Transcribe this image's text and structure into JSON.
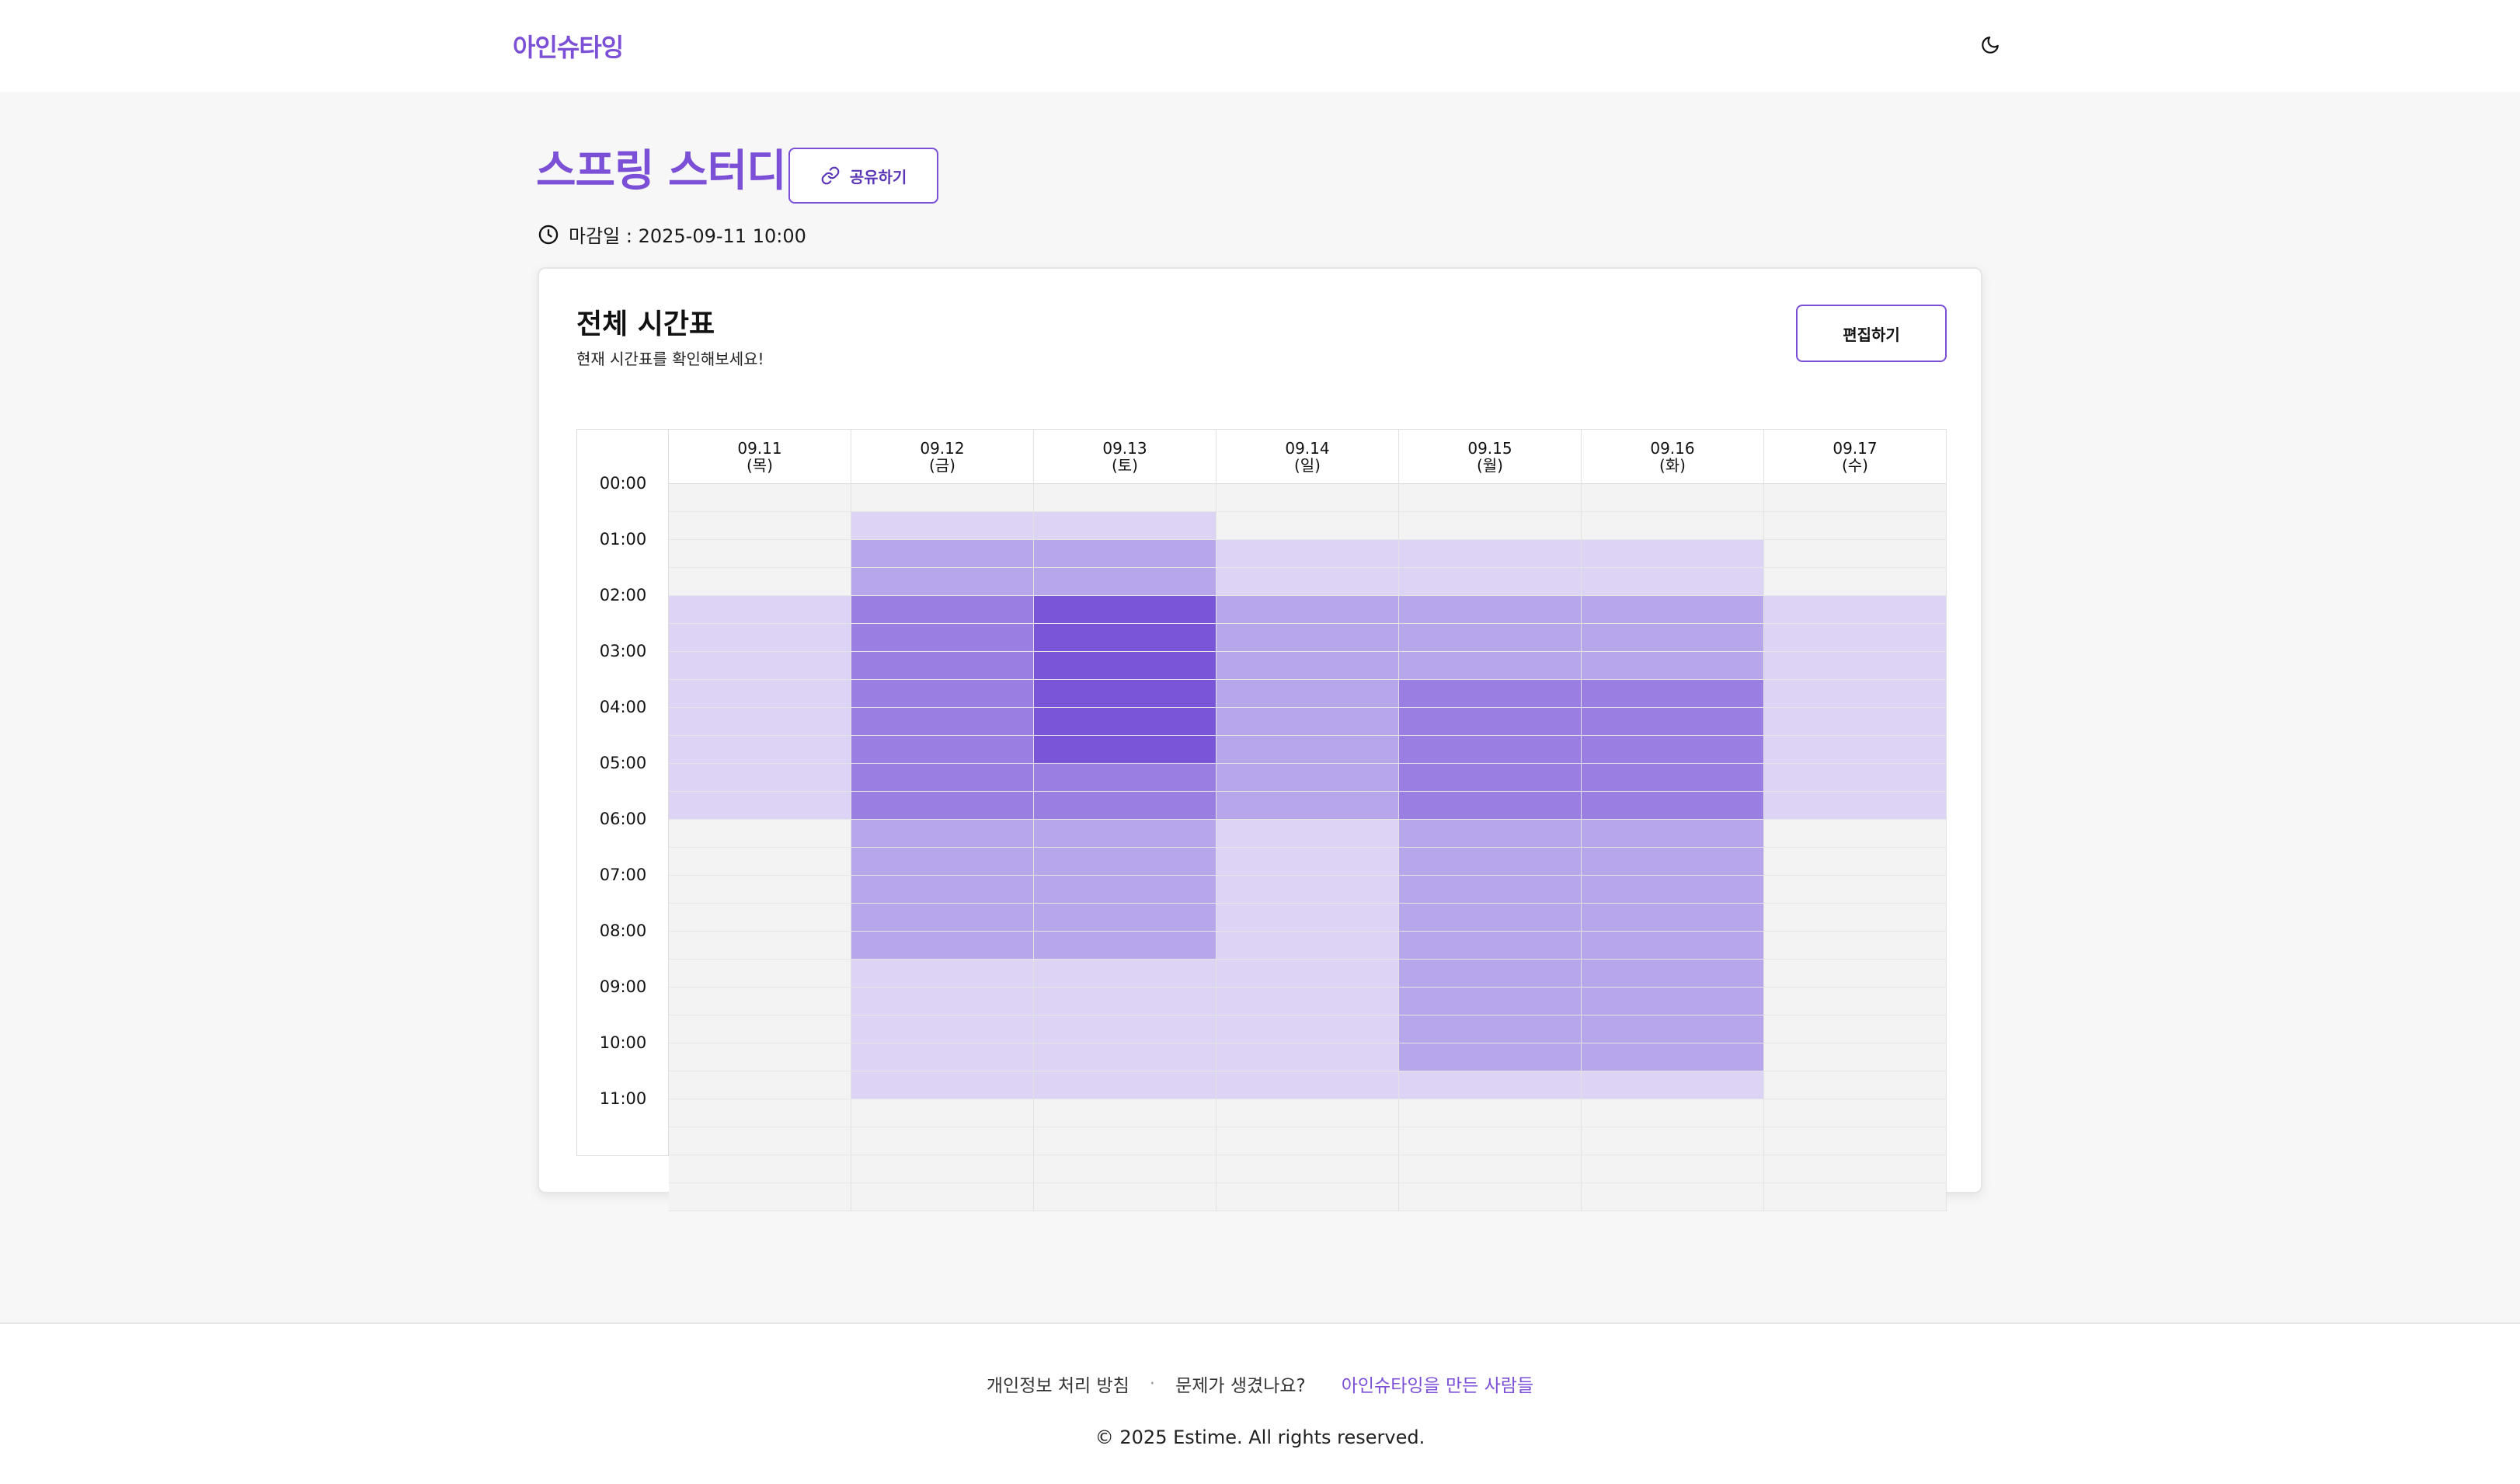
{
  "app": {
    "logo": "아인슈타잉",
    "theme_toggle_icon": "moon-icon"
  },
  "meeting": {
    "title": "스프링 스터디",
    "share_label": "공유하기",
    "deadline": "마감일 : 2025-09-11 10:00"
  },
  "timetable": {
    "title": "전체 시간표",
    "subtitle": "현재 시간표를 확인해보세요!",
    "edit_label": "편집하기",
    "days": [
      {
        "date": "09.11",
        "weekday": "(목)"
      },
      {
        "date": "09.12",
        "weekday": "(금)"
      },
      {
        "date": "09.13",
        "weekday": "(토)"
      },
      {
        "date": "09.14",
        "weekday": "(일)"
      },
      {
        "date": "09.15",
        "weekday": "(월)"
      },
      {
        "date": "09.16",
        "weekday": "(화)"
      },
      {
        "date": "09.17",
        "weekday": "(수)"
      }
    ],
    "time_labels": [
      "00:00",
      "01:00",
      "02:00",
      "03:00",
      "04:00",
      "05:00",
      "06:00",
      "07:00",
      "08:00",
      "09:00",
      "10:00",
      "11:00"
    ],
    "availability_levels_per_half_hour": [
      [
        0,
        0,
        0,
        0,
        1,
        1,
        1,
        1,
        1,
        1,
        1,
        1,
        0,
        0,
        0,
        0,
        0,
        0,
        0,
        0,
        0,
        0,
        0,
        0,
        0,
        0
      ],
      [
        0,
        1,
        2,
        2,
        3,
        3,
        3,
        3,
        3,
        3,
        3,
        3,
        2,
        2,
        2,
        2,
        2,
        1,
        1,
        1,
        1,
        1,
        0,
        0,
        0,
        0
      ],
      [
        0,
        1,
        2,
        2,
        4,
        4,
        4,
        4,
        4,
        4,
        3,
        3,
        2,
        2,
        2,
        2,
        2,
        1,
        1,
        1,
        1,
        1,
        0,
        0,
        0,
        0
      ],
      [
        0,
        0,
        1,
        1,
        2,
        2,
        2,
        2,
        2,
        2,
        2,
        2,
        1,
        1,
        1,
        1,
        1,
        1,
        1,
        1,
        1,
        1,
        0,
        0,
        0,
        0
      ],
      [
        0,
        0,
        1,
        1,
        2,
        2,
        2,
        3,
        3,
        3,
        3,
        3,
        2,
        2,
        2,
        2,
        2,
        2,
        2,
        2,
        2,
        1,
        0,
        0,
        0,
        0
      ],
      [
        0,
        0,
        1,
        1,
        2,
        2,
        2,
        3,
        3,
        3,
        3,
        3,
        2,
        2,
        2,
        2,
        2,
        2,
        2,
        2,
        2,
        1,
        0,
        0,
        0,
        0
      ],
      [
        0,
        0,
        0,
        0,
        1,
        1,
        1,
        1,
        1,
        1,
        1,
        1,
        0,
        0,
        0,
        0,
        0,
        0,
        0,
        0,
        0,
        0,
        0,
        0,
        0,
        0
      ]
    ],
    "level_colors": [
      "#f3f3f3",
      "#ddd3f4",
      "#b8a6ea",
      "#9a7ee2",
      "#7b55d8"
    ]
  },
  "footer": {
    "privacy_label": "개인정보 처리 방침",
    "separator": "·",
    "report_label": "문제가 생겼나요?",
    "team_label": "아인슈타잉을 만든 사람들",
    "copyright": "© 2025 Estime. All rights reserved."
  }
}
